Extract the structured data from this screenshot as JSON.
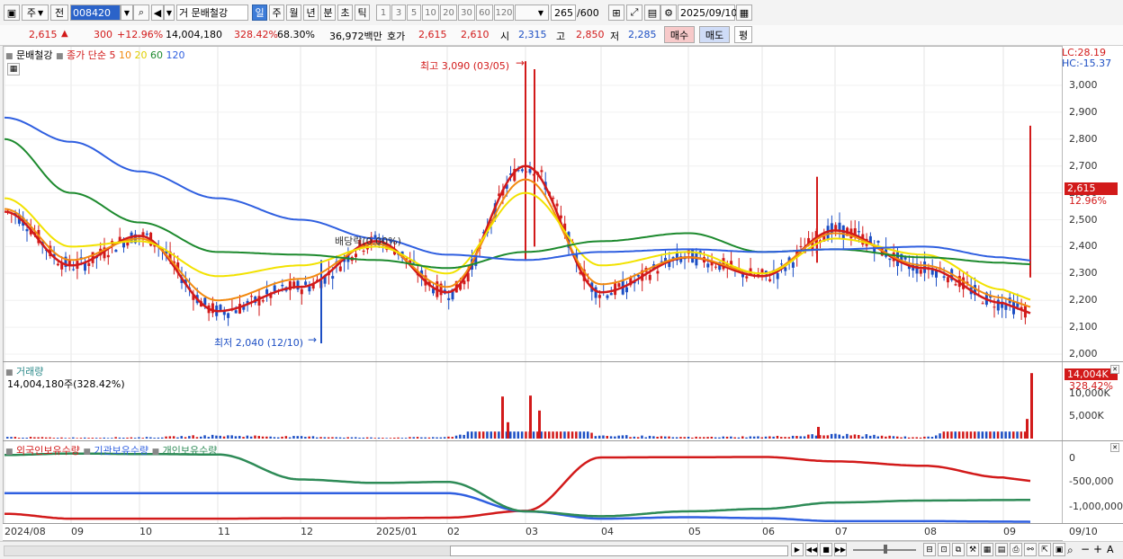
{
  "toolbar": {
    "market_label": "주",
    "prev_label": "전",
    "stock_code": "008420",
    "stock_name": "문배철강",
    "stock_prefix": "거",
    "period_buttons": [
      "일",
      "주",
      "월",
      "년",
      "분",
      "초",
      "틱"
    ],
    "interval_buttons": [
      "1",
      "3",
      "5",
      "10",
      "20",
      "30",
      "60",
      "120"
    ],
    "count_value": "265",
    "count_total": "/600",
    "date_value": "2025/09/10"
  },
  "quote": {
    "price": "2,615",
    "change": "300",
    "change_pct": "+12.96%",
    "volume": "14,004,180",
    "volume_ratio": "328.42%",
    "turnover": "68.30%",
    "amount": "36,972백만",
    "bid_label": "호가",
    "ask_price": "2,615",
    "bid_price": "2,610",
    "open_label": "시",
    "open": "2,315",
    "high_label": "고",
    "high": "2,850",
    "low_label": "저",
    "low": "2,285",
    "buy_label": "매수",
    "sell_label": "매도",
    "avg_label": "평"
  },
  "price_panel": {
    "stock_name": "문배철강",
    "ma_title": "종가 단순",
    "ma_periods": [
      "5",
      "10",
      "20",
      "60",
      "120"
    ],
    "lc": "LC:28.19",
    "hc": "HC:-15.37",
    "high_note": "최고 3,090 (03/05)",
    "low_note": "최저 2,040 (12/10)",
    "dividend_note": "배당락(0.00%)",
    "current_price": "2,615",
    "current_pct": "12.96%",
    "y_ticks": [
      "3,000",
      "2,900",
      "2,800",
      "2,700",
      "2,600",
      "2,500",
      "2,400",
      "2,300",
      "2,200",
      "2,100",
      "2,000"
    ]
  },
  "volume_panel": {
    "title": "거래량",
    "value_text": "14,004,180주(328.42%)",
    "current_value": "14,004K",
    "current_pct": "328.42%",
    "y_ticks": [
      "10,000K",
      "5,000K"
    ]
  },
  "holding_panel": {
    "series_names": [
      "외국인보유수량",
      "기관보유수량",
      "개인보유수량"
    ],
    "y_ticks": [
      "0",
      "-500,000",
      "-1,000,000"
    ]
  },
  "x_axis": {
    "labels": [
      "2024/08",
      "09",
      "10",
      "11",
      "12",
      "2025/01",
      "02",
      "03",
      "04",
      "05",
      "06",
      "07",
      "08",
      "09"
    ],
    "current": "09/10"
  },
  "colors": {
    "up": "#d21a1a",
    "down": "#1d4fc4",
    "ma5": "#d21a1a",
    "ma10": "#f28a10",
    "ma20": "#f2e200",
    "ma60": "#1d8a2e",
    "ma120": "#2f5fe0",
    "foreign": "#d21a1a",
    "institution": "#2f5fe0",
    "individual": "#2e8b57"
  },
  "chart_data": [
    {
      "type": "line",
      "title": "",
      "x": [
        "2024/08",
        "09",
        "10",
        "11",
        "12",
        "2025/01",
        "02",
        "03",
        "04",
        "05",
        "06",
        "07",
        "08",
        "09"
      ],
      "series": [
        {
          "name": "5",
          "values": [
            2530,
            2330,
            2440,
            2160,
            2250,
            2420,
            2230,
            2700,
            2230,
            2360,
            2290,
            2460,
            2320,
            2190
          ]
        },
        {
          "name": "10",
          "values": [
            2540,
            2350,
            2430,
            2200,
            2280,
            2410,
            2250,
            2650,
            2260,
            2360,
            2300,
            2450,
            2330,
            2210
          ]
        },
        {
          "name": "20",
          "values": [
            2580,
            2400,
            2420,
            2290,
            2330,
            2400,
            2300,
            2600,
            2330,
            2380,
            2300,
            2430,
            2370,
            2240
          ]
        },
        {
          "name": "60",
          "values": [
            2800,
            2600,
            2490,
            2380,
            2370,
            2350,
            2320,
            2380,
            2420,
            2450,
            2380,
            2390,
            2360,
            2340
          ]
        },
        {
          "name": "120",
          "values": [
            2880,
            2790,
            2680,
            2580,
            2500,
            2430,
            2370,
            2350,
            2380,
            2390,
            2380,
            2390,
            2400,
            2360
          ]
        }
      ],
      "ylim": [
        2000,
        3100
      ],
      "annotations": [
        "최고 3,090 (03/05)",
        "최저 2,040 (12/10)",
        "배당락(0.00%)"
      ]
    },
    {
      "type": "bar",
      "title": "거래량",
      "categories": [
        "2024/08",
        "09",
        "10",
        "11",
        "12",
        "2025/01",
        "02",
        "03",
        "04",
        "05",
        "06",
        "07",
        "08",
        "09"
      ],
      "values": [
        300,
        200,
        250,
        600,
        400,
        200,
        300,
        9000,
        600,
        300,
        400,
        800,
        300,
        14004
      ],
      "unit": "K",
      "ylim": [
        0,
        15000
      ]
    },
    {
      "type": "line",
      "x": [
        "2024/08",
        "09",
        "10",
        "11",
        "12",
        "2025/01",
        "02",
        "03",
        "04",
        "05",
        "06",
        "07",
        "08",
        "09"
      ],
      "series": [
        {
          "name": "외국인보유수량",
          "values": [
            -1150000,
            -1250000,
            -1250000,
            -1250000,
            -1240000,
            -1240000,
            -1230000,
            -1090000,
            0,
            5000,
            10000,
            -80000,
            -170000,
            -410000
          ]
        },
        {
          "name": "기관보유수량",
          "values": [
            -730000,
            -730000,
            -730000,
            -730000,
            -730000,
            -730000,
            -730000,
            -1100000,
            -1250000,
            -1220000,
            -1240000,
            -1300000,
            -1300000,
            -1310000
          ]
        },
        {
          "name": "개인보유수량",
          "values": [
            50000,
            80000,
            70000,
            60000,
            -450000,
            -520000,
            -500000,
            -1100000,
            -1200000,
            -1100000,
            -1050000,
            -920000,
            -880000,
            -870000
          ]
        }
      ],
      "ylim": [
        -1300000,
        100000
      ]
    }
  ]
}
